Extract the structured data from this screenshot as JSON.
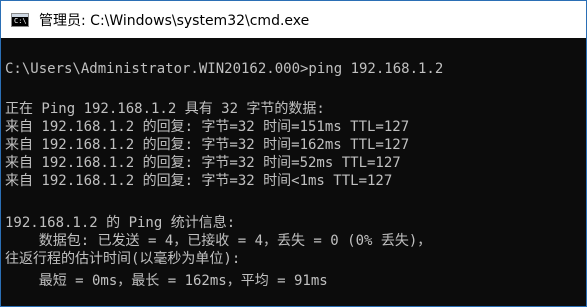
{
  "window": {
    "title": "管理员: C:\\Windows\\system32\\cmd.exe",
    "icon": "cmd-icon",
    "icon_glyph": "C:\\"
  },
  "console": {
    "lines": [
      "C:\\Users\\Administrator.WIN20162.000>ping 192.168.1.2",
      "",
      "正在 Ping 192.168.1.2 具有 32 字节的数据:",
      "来自 192.168.1.2 的回复: 字节=32 时间=151ms TTL=127",
      "来自 192.168.1.2 的回复: 字节=32 时间=162ms TTL=127",
      "来自 192.168.1.2 的回复: 字节=32 时间=52ms TTL=127",
      "来自 192.168.1.2 的回复: 字节=32 时间<1ms TTL=127",
      "",
      "192.168.1.2 的 Ping 统计信息:",
      "    数据包: 已发送 = 4，已接收 = 4，丢失 = 0 (0% 丢失)，",
      "往返行程的估计时间(以毫秒为单位):",
      "    最短 = 0ms，最长 = 162ms，平均 = 91ms"
    ]
  },
  "colors": {
    "console_bg": "#0c0c0c",
    "console_text": "#c0c0c0",
    "titlebar_bg": "#ffffff"
  }
}
